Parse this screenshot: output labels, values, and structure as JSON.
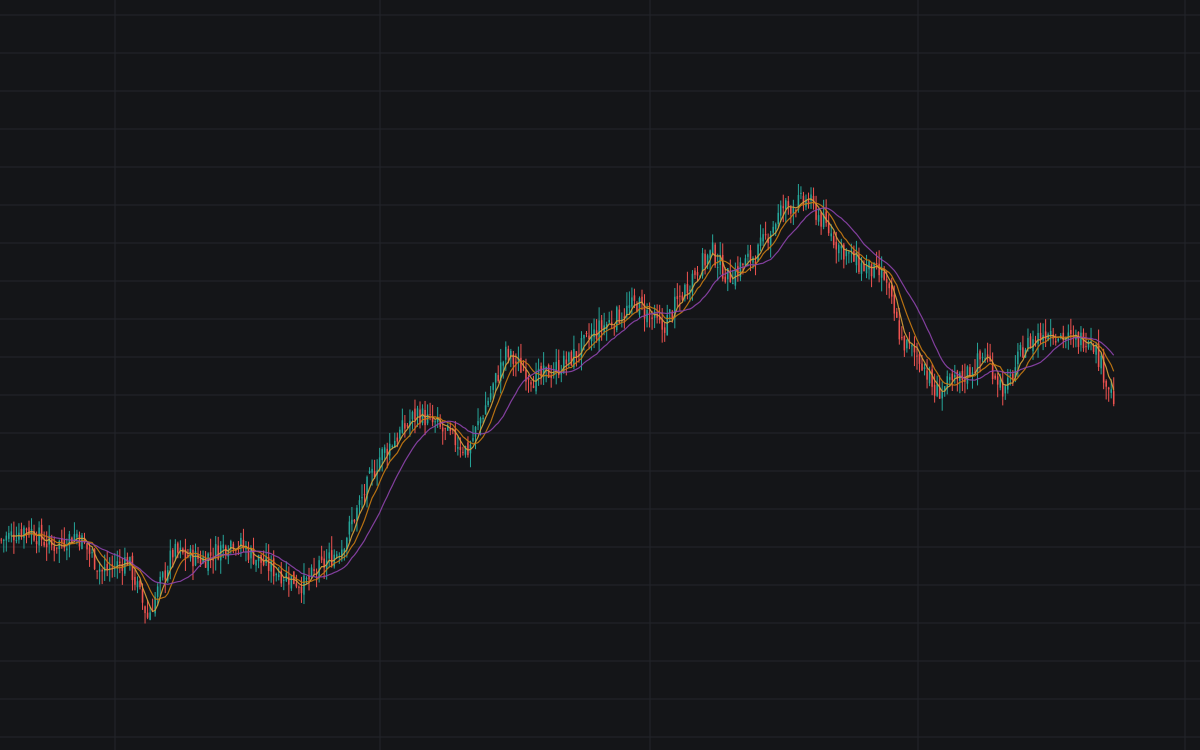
{
  "colors": {
    "background": "#141518",
    "grid": "#23252b",
    "up": "#26a69a",
    "down": "#ef5350",
    "ma_fast": "#d9a23a",
    "ma_mid": "#c97b12",
    "ma_slow": "#8e44ad"
  },
  "chart_data": {
    "type": "candlestick",
    "title": "",
    "xlabel": "",
    "ylabel": "",
    "grid": true,
    "ylim": [
      0,
      100
    ],
    "series": [
      {
        "name": "",
        "kind": "ohlc",
        "anchors": [
          [
            0,
            25
          ],
          [
            10,
            27
          ],
          [
            20,
            24
          ],
          [
            30,
            26
          ],
          [
            40,
            20
          ],
          [
            50,
            22
          ],
          [
            58,
            13
          ],
          [
            68,
            23
          ],
          [
            80,
            22
          ],
          [
            92,
            25
          ],
          [
            105,
            21
          ],
          [
            120,
            18
          ],
          [
            135,
            24
          ],
          [
            150,
            38
          ],
          [
            165,
            45
          ],
          [
            175,
            42
          ],
          [
            185,
            39
          ],
          [
            193,
            47
          ],
          [
            200,
            54
          ],
          [
            212,
            50
          ],
          [
            225,
            53
          ],
          [
            237,
            58
          ],
          [
            252,
            62
          ],
          [
            262,
            58
          ],
          [
            275,
            67
          ],
          [
            282,
            70
          ],
          [
            288,
            66
          ],
          [
            300,
            70
          ],
          [
            310,
            77
          ],
          [
            320,
            78
          ],
          [
            332,
            71
          ],
          [
            340,
            68
          ],
          [
            350,
            66
          ],
          [
            357,
            56
          ],
          [
            365,
            53
          ],
          [
            370,
            48
          ],
          [
            380,
            50
          ],
          [
            390,
            54
          ],
          [
            398,
            48
          ],
          [
            405,
            55
          ],
          [
            415,
            58
          ],
          [
            425,
            56
          ],
          [
            432,
            57
          ],
          [
            438,
            50
          ],
          [
            442,
            46
          ]
        ],
        "count": 442,
        "seed": 7
      },
      {
        "name": "",
        "kind": "moving-average",
        "period": 5
      },
      {
        "name": "",
        "kind": "moving-average",
        "period": 10
      },
      {
        "name": "",
        "kind": "moving-average",
        "period": 20
      }
    ]
  }
}
